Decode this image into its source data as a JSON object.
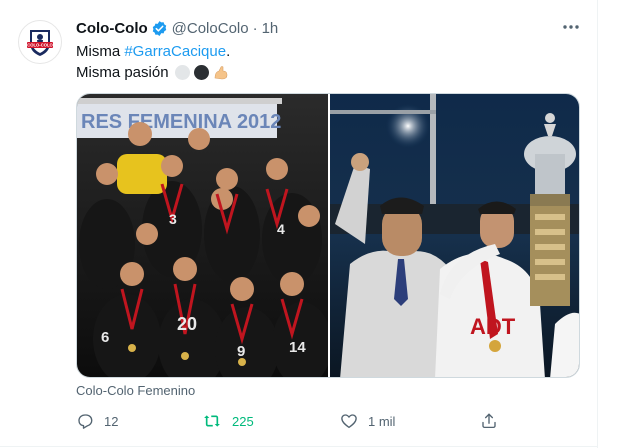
{
  "tweet": {
    "display_name": "Colo-Colo",
    "handle": "@ColoColo",
    "separator": "·",
    "time": "1h",
    "line1_prefix": "Misma ",
    "hashtag": "#GarraCacique",
    "line1_suffix": ".",
    "line2": "Misma pasión",
    "emojis": [
      "white-circle",
      "black-circle",
      "flexed-biceps"
    ],
    "media_caption": "Colo-Colo Femenino",
    "more_icon": "ellipsis-icon"
  },
  "avatar": {
    "badge_text": "COLO-COLO"
  },
  "media": {
    "left_photo": {
      "banner_text": "RES FEMENINA 2012",
      "jersey_numbers": [
        "3",
        "4",
        "6",
        "20",
        "9",
        "14"
      ]
    },
    "right_photo": {
      "jersey_text": "ADT"
    }
  },
  "actions": {
    "reply": {
      "icon": "reply-icon",
      "count": "12"
    },
    "retweet": {
      "icon": "retweet-icon",
      "count": "225"
    },
    "like": {
      "icon": "heart-icon",
      "count": "1 mil"
    },
    "share": {
      "icon": "share-icon"
    }
  },
  "colors": {
    "text_primary": "#0f1419",
    "text_secondary": "#536471",
    "link": "#1d9bf0",
    "retweet_active": "#00ba7c",
    "border": "#cfd9de"
  }
}
